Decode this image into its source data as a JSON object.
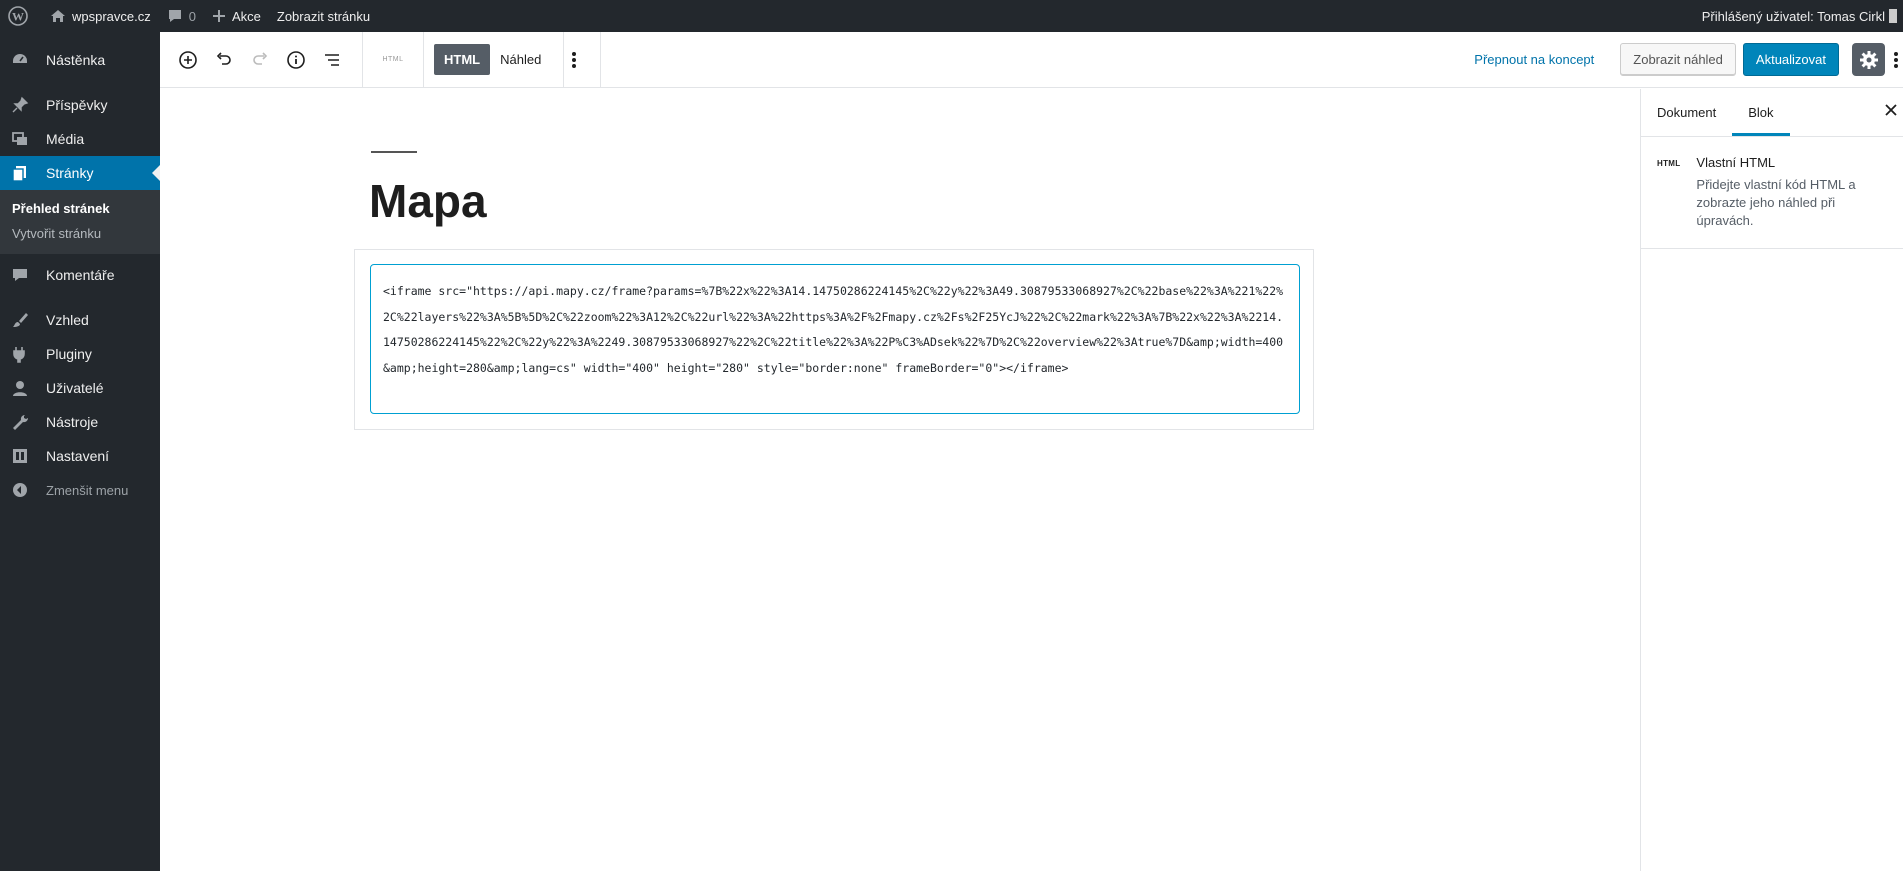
{
  "adminbar": {
    "site_name": "wpspravce.cz",
    "comments_count": "0",
    "new_label": "Akce",
    "view_page": "Zobrazit stránku",
    "user_greeting": "Přihlášený uživatel: Tomas Cirkl"
  },
  "sidebar": {
    "items": [
      {
        "label": "Nástěnka",
        "icon": "dashboard-icon"
      },
      {
        "label": "Příspěvky",
        "icon": "pin-icon"
      },
      {
        "label": "Média",
        "icon": "media-icon"
      },
      {
        "label": "Stránky",
        "icon": "pages-icon"
      },
      {
        "label": "Komentáře",
        "icon": "comments-icon"
      },
      {
        "label": "Vzhled",
        "icon": "brush-icon"
      },
      {
        "label": "Pluginy",
        "icon": "plugin-icon"
      },
      {
        "label": "Uživatelé",
        "icon": "user-icon"
      },
      {
        "label": "Nástroje",
        "icon": "wrench-icon"
      },
      {
        "label": "Nastavení",
        "icon": "settings-icon"
      }
    ],
    "submenu": [
      "Přehled stránek",
      "Vytvořit stránku"
    ],
    "collapse_label": "Zmenšit menu"
  },
  "toolbar": {
    "block_chip": "HTML",
    "tab_html": "HTML",
    "tab_preview": "Náhled",
    "switch_draft": "Přepnout na koncept",
    "preview": "Zobrazit náhled",
    "update": "Aktualizovat"
  },
  "settings": {
    "tabs": [
      "Dokument",
      "Blok"
    ],
    "active_tab": "Blok",
    "block_icon": "HTML",
    "block_name": "Vlastní HTML",
    "block_desc": "Přidejte vlastní kód HTML a zobrazte jeho náhled při úpravách."
  },
  "post": {
    "title": "Mapa",
    "html_code": "<iframe src=\"https://api.mapy.cz/frame?params=%7B%22x%22%3A14.14750286224145%2C%22y%22%3A49.30879533068927%2C%22base%22%3A%221%22%2C%22layers%22%3A%5B%5D%2C%22zoom%22%3A12%2C%22url%22%3A%22https%3A%2F%2Fmapy.cz%2Fs%2F25YcJ%22%2C%22mark%22%3A%7B%22x%22%3A%2214.14750286224145%22%2C%22y%22%3A%2249.30879533068927%22%2C%22title%22%3A%22P%C3%ADsek%22%7D%2C%22overview%22%3Atrue%7D&amp;width=400&amp;height=280&amp;lang=cs\" width=\"400\" height=\"280\" style=\"border:none\" frameBorder=\"0\"></iframe>"
  },
  "colors": {
    "admin_dark": "#23282d",
    "accent": "#0073aa",
    "primary_button": "#0085ba"
  }
}
